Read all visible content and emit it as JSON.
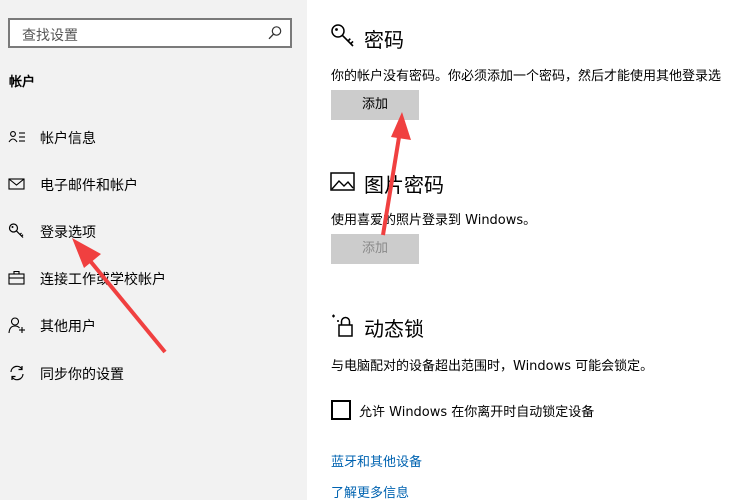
{
  "sidebar": {
    "search_placeholder": "查找设置",
    "section_title": "帐户",
    "items": [
      {
        "label": "帐户信息",
        "icon": "person-card-icon"
      },
      {
        "label": "电子邮件和帐户",
        "icon": "mail-icon"
      },
      {
        "label": "登录选项",
        "icon": "key-icon"
      },
      {
        "label": "连接工作或学校帐户",
        "icon": "briefcase-icon"
      },
      {
        "label": "其他用户",
        "icon": "person-add-icon"
      },
      {
        "label": "同步你的设置",
        "icon": "sync-icon"
      }
    ]
  },
  "password": {
    "title": "密码",
    "desc": "你的帐户没有密码。你必须添加一个密码，然后才能使用其他登录选",
    "button": "添加"
  },
  "picture_password": {
    "title": "图片密码",
    "desc": "使用喜爱的照片登录到 Windows。",
    "button": "添加"
  },
  "dynamic_lock": {
    "title": "动态锁",
    "desc": "与电脑配对的设备超出范围时，Windows 可能会锁定。",
    "checkbox_label": "允许 Windows 在你离开时自动锁定设备"
  },
  "links": {
    "bluetooth": "蓝牙和其他设备",
    "learn_more": "了解更多信息"
  },
  "colors": {
    "accent_link": "#0063b1",
    "annotation_arrow": "#f04040"
  }
}
